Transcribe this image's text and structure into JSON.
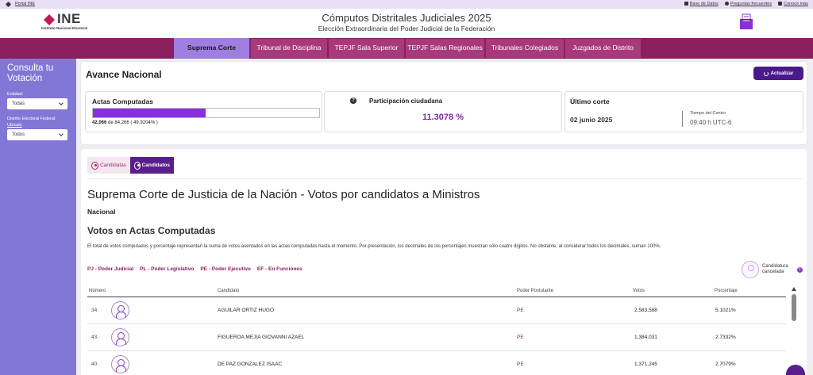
{
  "topbar": {
    "portal": "Portal INE",
    "links": [
      "Base de Datos",
      "Preguntas frecuentes",
      "Conoce más"
    ]
  },
  "header": {
    "logo": "INE",
    "logo_sub": "Instituto Nacional Electoral",
    "title": "Cómputos Distritales Judiciales 2025",
    "subtitle": "Elección Extraordinaria del Poder Judicial de la Federación"
  },
  "nav": {
    "items": [
      {
        "label": "Suprema Corte"
      },
      {
        "label": "Tribunal de Disciplina"
      },
      {
        "label": "TEPJF Sala Superior"
      },
      {
        "label": "TEPJF Salas Regionales"
      },
      {
        "label": "Tribunales Colegiados"
      },
      {
        "label": "Juzgados de Distrito"
      }
    ],
    "active": "Suprema Corte"
  },
  "sidebar": {
    "title": "Consulta tu Votación",
    "entidad_label": "Entidad:",
    "entidad_value": "Todas",
    "distrito_label": "Distrito Electoral Federal:",
    "ubicalo": "Ubícalo",
    "distrito_value": "Todos"
  },
  "avance": {
    "title": "Avance Nacional",
    "update_button": "Actualizar",
    "actas_title": "Actas Computadas",
    "actas_count": "42,066",
    "actas_total": "de 84,266",
    "actas_pct": "( 49.9204% )",
    "actas_progress": 0.499204,
    "participacion_title": "Participación ciudadana",
    "participacion_value": "11.3078 %",
    "corte_title": "Último corte",
    "corte_date": "02 junio 2025",
    "corte_time_label": "Tiempo del Centro",
    "corte_time": "09:40 h UTC-6"
  },
  "main": {
    "tabs": [
      "Candidatas",
      "Candidatos"
    ],
    "active_tab": "Candidatos",
    "title": "Suprema Corte de Justicia de la Nación - Votos por candidatos a Ministros",
    "scope": "Nacional",
    "section_title": "Votos en Actas Computadas",
    "description": "El total de votos computados y porcentaje representan la suma de votos asentados en las actas computadas hasta el momento. Por presentación, los decimales de los porcentajes muestran sólo cuatro dígitos. No obstante, al considerar todos los decimales, suman 100%.",
    "legend": [
      "PJ - Poder Judicial",
      "PL - Poder Legislativo",
      "PE - Poder Ejecutivo",
      "EF - En Funciones"
    ],
    "cancelada": "Candidatura cancelada",
    "columns": [
      "Número",
      "Candidato",
      "Poder Postulante",
      "Votos",
      "Porcentaje"
    ],
    "rows": [
      {
        "numero": "34",
        "candidato": "AGUILAR ORTIZ HUGO",
        "poder": "PE",
        "votos": "2,583,588",
        "porcentaje": "5.1021%"
      },
      {
        "numero": "43",
        "candidato": "FIGUEROA MEJIA GIOVANNI AZAEL",
        "poder": "PE",
        "votos": "1,384,031",
        "porcentaje": "2.7332%"
      },
      {
        "numero": "40",
        "candidato": "DE PAZ GONZALEZ ISAAC",
        "poder": "PE",
        "votos": "1,371,245",
        "porcentaje": "2.7079%"
      }
    ]
  },
  "colors": {
    "nav_bg": "#8a1f5f",
    "nav_active": "#a07ee0",
    "sidebar": "#8277d6",
    "accent": "#4b1a8a",
    "progress": "#8b2fd8"
  }
}
